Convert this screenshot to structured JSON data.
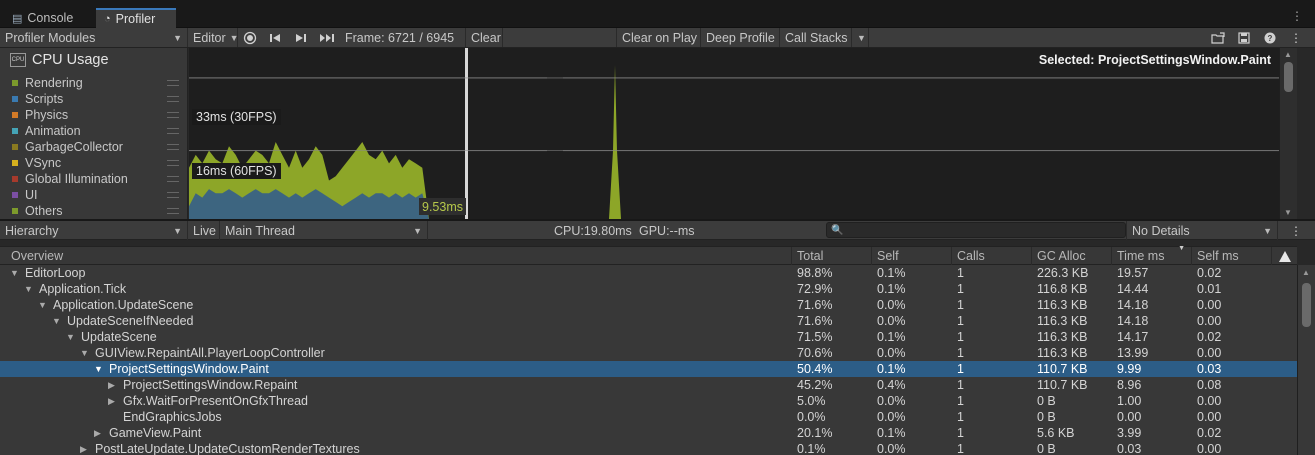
{
  "tabs": {
    "console": "Console",
    "profiler": "Profiler",
    "menu_icon": "vertical-dots-icon"
  },
  "toolbar": {
    "modules": "Profiler Modules",
    "target": "Editor",
    "frame": "Frame: 6721 / 6945",
    "clear": "Clear",
    "clear_on_play": "Clear on Play",
    "deep_profile": "Deep Profile",
    "call_stacks": "Call Stacks",
    "icons": [
      "record-icon",
      "step-back-icon",
      "step-forward-icon",
      "skip-to-end-icon",
      "load-icon",
      "save-icon",
      "help-icon",
      "more-icon"
    ]
  },
  "module": {
    "title": "CPU Usage",
    "icon_text": "CPU",
    "legend": [
      {
        "label": "Rendering",
        "color": "#7c9a2c"
      },
      {
        "label": "Scripts",
        "color": "#3a7ab0"
      },
      {
        "label": "Physics",
        "color": "#d27a27"
      },
      {
        "label": "Animation",
        "color": "#45a4b6"
      },
      {
        "label": "GarbageCollector",
        "color": "#8a7a20"
      },
      {
        "label": "VSync",
        "color": "#d6b11e"
      },
      {
        "label": "Global Illumination",
        "color": "#a63a2c"
      },
      {
        "label": "UI",
        "color": "#7b4fa3"
      },
      {
        "label": "Others",
        "color": "#7d9a2c"
      }
    ]
  },
  "chart_data": {
    "type": "area",
    "title": "",
    "xlabel": "",
    "ylabel": "",
    "reference_lines": [
      {
        "label": "33ms (30FPS)",
        "value": 33
      },
      {
        "label": "16ms (60FPS)",
        "value": 16
      }
    ],
    "selected_label": "Selected: ProjectSettingsWindow.Paint",
    "selected_value_label": "9.53ms",
    "selected_frame": 6721,
    "ylim": [
      0,
      40
    ],
    "grid": false,
    "series": [
      {
        "name": "Scripts",
        "color": "#3d6580",
        "values": [
          3,
          6,
          5,
          7,
          6,
          6,
          7,
          6,
          5,
          6,
          7,
          6,
          6,
          7,
          6,
          5,
          6,
          5,
          6,
          7,
          6,
          5,
          4,
          3,
          4,
          5,
          6,
          5,
          6,
          6,
          5,
          6,
          5,
          6,
          5,
          6,
          0,
          0,
          0,
          0,
          0,
          0,
          0,
          0,
          0,
          0,
          0,
          0,
          0,
          0,
          0,
          0,
          0,
          0,
          0,
          0,
          0,
          0,
          0,
          0,
          0,
          0,
          0,
          0,
          0,
          0,
          0,
          0,
          0,
          0,
          0,
          0,
          0,
          0,
          0,
          0,
          0,
          0,
          0,
          0,
          0,
          0,
          0,
          0,
          0,
          0,
          0,
          0,
          0,
          0
        ]
      },
      {
        "name": "Rendering",
        "color": "#8da628",
        "values": [
          12,
          15,
          13,
          16,
          14,
          13,
          17,
          15,
          12,
          14,
          16,
          15,
          13,
          18,
          15,
          12,
          16,
          12,
          14,
          17,
          15,
          9,
          10,
          12,
          14,
          16,
          18,
          15,
          14,
          16,
          13,
          15,
          12,
          14,
          13,
          12,
          0,
          0,
          0,
          0,
          0,
          0,
          0,
          0,
          0,
          0,
          0,
          0,
          0,
          0,
          0,
          0,
          0,
          0,
          0,
          0,
          0,
          0,
          0,
          0,
          0,
          0,
          0,
          0,
          0,
          0,
          0,
          0,
          0,
          0,
          0,
          0,
          0,
          0,
          0,
          0,
          0,
          0,
          0,
          0,
          0,
          0,
          0,
          0,
          0,
          0,
          0,
          0,
          0,
          0
        ]
      }
    ]
  },
  "hierarchy_toolbar": {
    "view": "Hierarchy",
    "live": "Live",
    "thread": "Main Thread",
    "cpu": "CPU:19.80ms",
    "gpu": "GPU:--ms",
    "search_placeholder": "",
    "details": "No Details"
  },
  "table": {
    "columns": [
      "Overview",
      "Total",
      "Self",
      "Calls",
      "GC Alloc",
      "Time ms",
      "Self ms"
    ],
    "rows": [
      {
        "depth": 0,
        "expander": "open",
        "name": "EditorLoop",
        "total": "98.8%",
        "self": "0.1%",
        "calls": "1",
        "gc": "226.3 KB",
        "time": "19.57",
        "selfms": "0.02"
      },
      {
        "depth": 1,
        "expander": "open",
        "name": "Application.Tick",
        "total": "72.9%",
        "self": "0.1%",
        "calls": "1",
        "gc": "116.8 KB",
        "time": "14.44",
        "selfms": "0.01"
      },
      {
        "depth": 2,
        "expander": "open",
        "name": "Application.UpdateScene",
        "total": "71.6%",
        "self": "0.0%",
        "calls": "1",
        "gc": "116.3 KB",
        "time": "14.18",
        "selfms": "0.00"
      },
      {
        "depth": 3,
        "expander": "open",
        "name": "UpdateSceneIfNeeded",
        "total": "71.6%",
        "self": "0.0%",
        "calls": "1",
        "gc": "116.3 KB",
        "time": "14.18",
        "selfms": "0.00"
      },
      {
        "depth": 4,
        "expander": "open",
        "name": "UpdateScene",
        "total": "71.5%",
        "self": "0.1%",
        "calls": "1",
        "gc": "116.3 KB",
        "time": "14.17",
        "selfms": "0.02"
      },
      {
        "depth": 5,
        "expander": "open",
        "name": "GUIView.RepaintAll.PlayerLoopController",
        "total": "70.6%",
        "self": "0.0%",
        "calls": "1",
        "gc": "116.3 KB",
        "time": "13.99",
        "selfms": "0.00"
      },
      {
        "depth": 6,
        "expander": "open",
        "name": "ProjectSettingsWindow.Paint",
        "total": "50.4%",
        "self": "0.1%",
        "calls": "1",
        "gc": "110.7 KB",
        "time": "9.99",
        "selfms": "0.03",
        "selected": true
      },
      {
        "depth": 7,
        "expander": "closed",
        "name": "ProjectSettingsWindow.Repaint",
        "total": "45.2%",
        "self": "0.4%",
        "calls": "1",
        "gc": "110.7 KB",
        "time": "8.96",
        "selfms": "0.08"
      },
      {
        "depth": 7,
        "expander": "closed",
        "name": "Gfx.WaitForPresentOnGfxThread",
        "total": "5.0%",
        "self": "0.0%",
        "calls": "1",
        "gc": "0 B",
        "time": "1.00",
        "selfms": "0.00"
      },
      {
        "depth": 7,
        "expander": "none",
        "name": "EndGraphicsJobs",
        "total": "0.0%",
        "self": "0.0%",
        "calls": "1",
        "gc": "0 B",
        "time": "0.00",
        "selfms": "0.00"
      },
      {
        "depth": 6,
        "expander": "closed",
        "name": "GameView.Paint",
        "total": "20.1%",
        "self": "0.1%",
        "calls": "1",
        "gc": "5.6 KB",
        "time": "3.99",
        "selfms": "0.02"
      },
      {
        "depth": 5,
        "expander": "closed",
        "name": "PostLateUpdate.UpdateCustomRenderTextures",
        "total": "0.1%",
        "self": "0.0%",
        "calls": "1",
        "gc": "0 B",
        "time": "0.03",
        "selfms": "0.00"
      }
    ]
  },
  "colors": {
    "selection": "#2c5d87",
    "tab_accent": "#3a79bb"
  }
}
